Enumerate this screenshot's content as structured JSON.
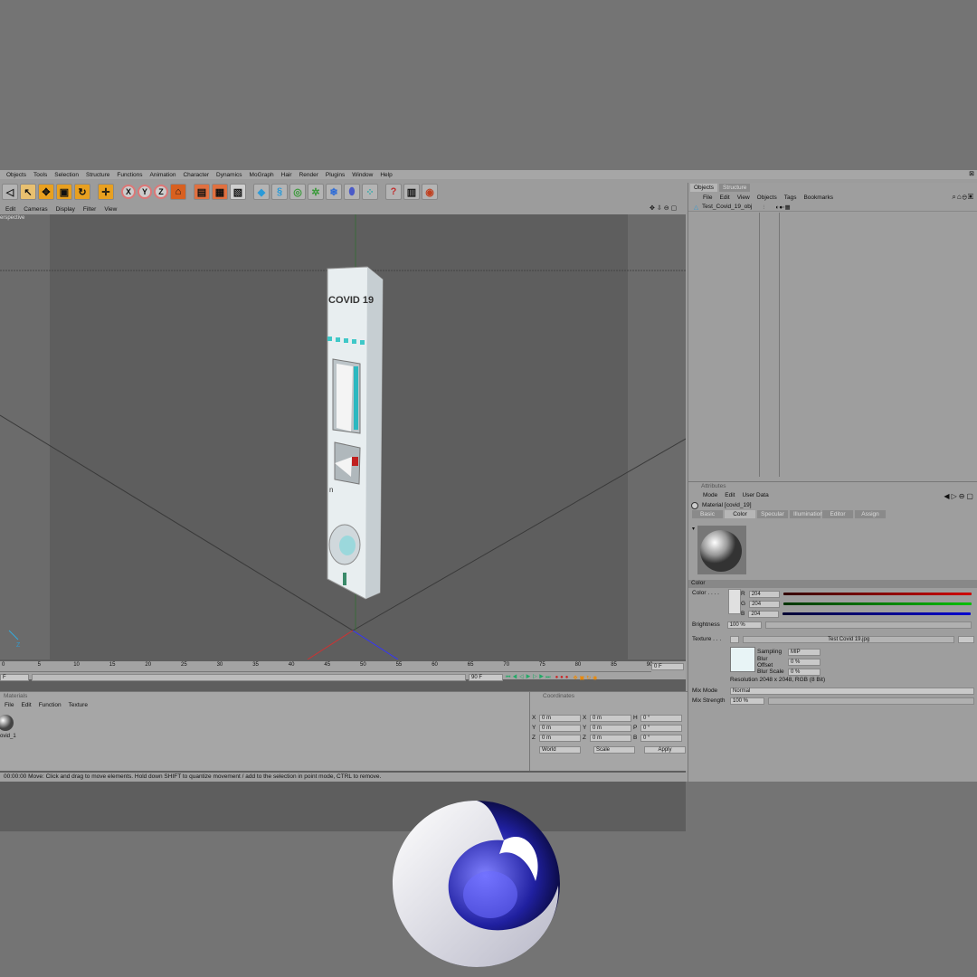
{
  "menubar": [
    "Objects",
    "Tools",
    "Selection",
    "Structure",
    "Functions",
    "Animation",
    "Character",
    "Dynamics",
    "MoGraph",
    "Hair",
    "Render",
    "Plugins",
    "Window",
    "Help"
  ],
  "axis_buttons": [
    "X",
    "Y",
    "Z"
  ],
  "viewport": {
    "menu": [
      "Edit",
      "Cameras",
      "Display",
      "Filter",
      "View"
    ],
    "label": "erspective",
    "product_text": "COVID 19",
    "marker_text": "n"
  },
  "timeline": {
    "ticks": [
      "0",
      "5",
      "10",
      "15",
      "20",
      "25",
      "30",
      "35",
      "40",
      "45",
      "50",
      "55",
      "60",
      "65",
      "70",
      "75",
      "80",
      "85",
      "90"
    ],
    "end_field": "0 F",
    "start_field": "F",
    "frame_field": "90 F"
  },
  "materials": {
    "title": "Materials",
    "menu": [
      "File",
      "Edit",
      "Function",
      "Texture"
    ],
    "item_label": "ovid_1"
  },
  "coords": {
    "title": "Coordinates",
    "rows": [
      [
        "X",
        "0 m",
        "X",
        "0 m",
        "H",
        "0 °"
      ],
      [
        "Y",
        "0 m",
        "Y",
        "0 m",
        "P",
        "0 °"
      ],
      [
        "Z",
        "0 m",
        "Z",
        "0 m",
        "B",
        "0 °"
      ]
    ],
    "world": "World",
    "scale": "Scale",
    "apply": "Apply"
  },
  "status": "00:00:00   Move: Click and drag to move elements. Hold down SHIFT to quantize movement / add to the selection in point mode, CTRL to remove.",
  "objects": {
    "tabs": [
      "Objects",
      "Structure"
    ],
    "menu": [
      "File",
      "Edit",
      "View",
      "Objects",
      "Tags",
      "Bookmarks"
    ],
    "item": "Test_Covid_19_obj"
  },
  "attributes": {
    "title": "Attributes",
    "menu": [
      "Mode",
      "Edit",
      "User Data"
    ],
    "material": "Material [covid_19]",
    "tabs": [
      "Basic",
      "Color",
      "Specular",
      "Illumination",
      "Editor",
      "Assign"
    ],
    "section": "Color",
    "color_label": "Color . . . .",
    "r": "204",
    "g": "204",
    "b": "204",
    "brightness_label": "Brightness",
    "brightness": "100 %",
    "texture_label": "Texture . . .",
    "texture_name": "Test Covid 19.jpg",
    "sampling_label": "Sampling",
    "sampling": "MIP",
    "blur_offset_label": "Blur Offset",
    "blur_offset": "0 %",
    "blur_scale_label": "Blur Scale",
    "blur_scale": "0 %",
    "resolution": "Resolution 2048 x 2048, RGB (8 Bit)",
    "mix_mode_label": "Mix Mode",
    "mix_mode": "Normal",
    "mix_strength_label": "Mix Strength",
    "mix_strength": "100 %"
  },
  "colors": {
    "accent_orange": "#e8a020",
    "red": "#d00000",
    "green": "#00c000",
    "blue": "#0000d0",
    "teal": "#40c8c8"
  }
}
